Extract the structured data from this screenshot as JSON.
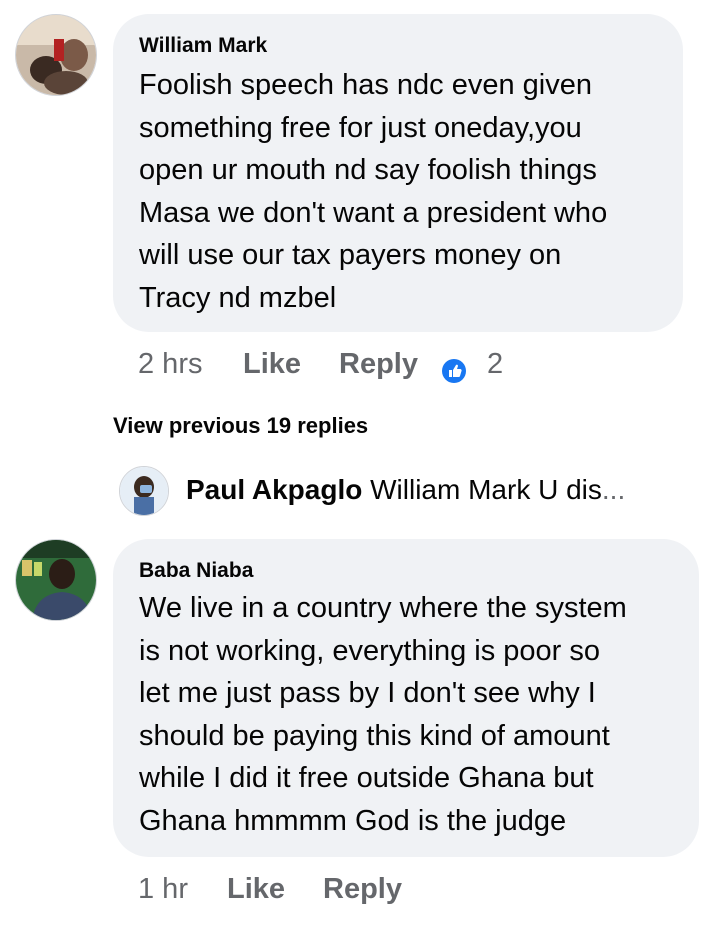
{
  "comments": [
    {
      "author": "William Mark",
      "text": "Foolish speech has ndc even given\nsomething free for just oneday,you\nopen ur mouth nd say foolish things\nMasa we don't want a president who\nwill use our tax payers money on\nTracy nd mzbel",
      "time": "2 hrs",
      "like_label": "Like",
      "reply_label": "Reply",
      "reaction_count": "2",
      "reaction_icon": "like-icon"
    },
    {
      "author": "Baba Niaba",
      "text": "We live in a country where the system\nis not working, everything is poor so\nlet me just pass by I don't see why I\nshould be paying this kind of amount\nwhile I did it free outside Ghana but\nGhana hmmmm God is the judge",
      "time": "1 hr",
      "like_label": "Like",
      "reply_label": "Reply"
    }
  ],
  "view_previous_replies": "View previous 19 replies",
  "reply_preview": {
    "author": "Paul Akpaglo",
    "snippet": "William Mark U dis",
    "ellipsis": "..."
  },
  "colors": {
    "bubble": "#f0f2f5",
    "meta_text": "#65676b",
    "like_blue": "#1877f2"
  }
}
